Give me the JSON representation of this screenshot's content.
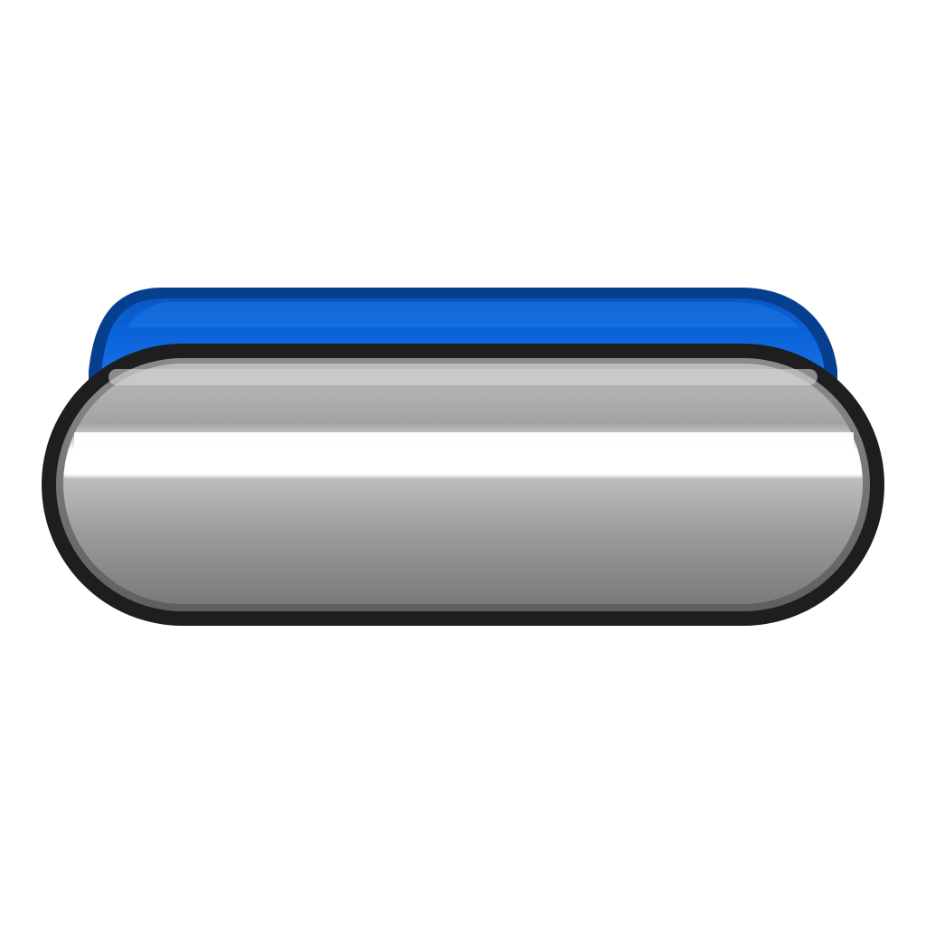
{
  "icon": {
    "name": "glossy-pill-button-icon",
    "colors": {
      "background": "#ffffff",
      "back_plate": "#0a63d8",
      "back_plate_edge": "#073f8f",
      "front_outline": "#1e1e1e",
      "front_body_light": "#c9c9c9",
      "front_body_mid": "#9a9a9a",
      "front_body_dark": "#7a7a7a",
      "highlight": "#ffffff"
    }
  }
}
